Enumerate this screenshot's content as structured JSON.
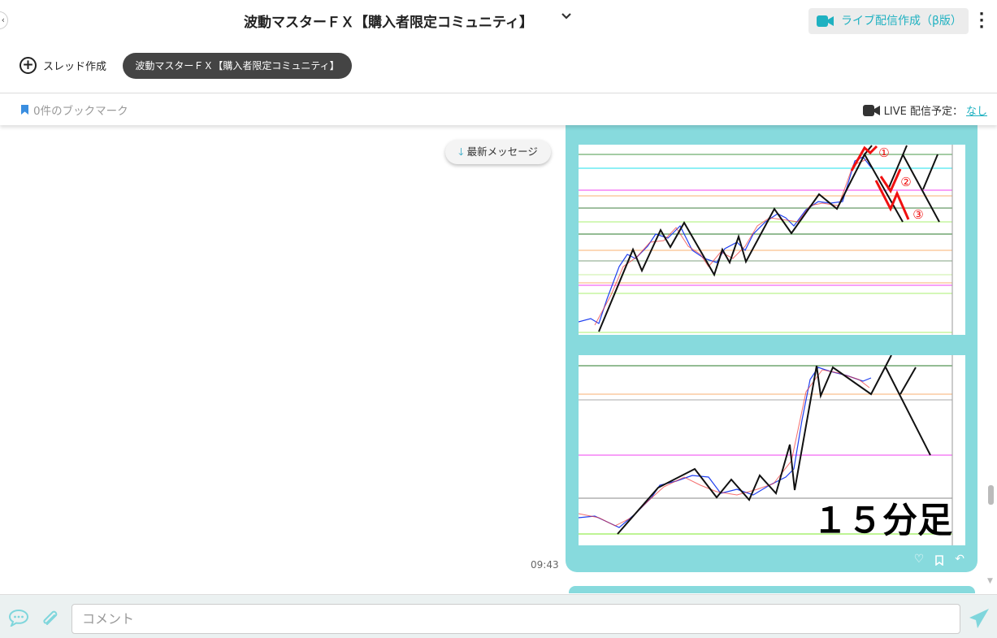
{
  "header": {
    "title": "波動マスターＦＸ【購入者限定コミュニティ】",
    "live_button": "ライブ配信作成（β版）"
  },
  "threads": {
    "new_thread": "スレッド作成",
    "active": "波動マスターＦＸ【購入者限定コミュニティ】"
  },
  "subbar": {
    "bookmarks": "0件のブックマーク",
    "live_schedule_label": "LIVE 配信予定：",
    "live_schedule_value": "なし"
  },
  "chat": {
    "latest_button": "最新メッセージ",
    "message": {
      "time": "09:43",
      "image2_caption": "１５分足",
      "annotations": [
        "①",
        "②",
        "③"
      ]
    }
  },
  "footer": {
    "comment_placeholder": "コメント"
  },
  "colors": {
    "accent": "#1fb1c1",
    "bubble": "#87dadd",
    "chip": "#444444"
  }
}
